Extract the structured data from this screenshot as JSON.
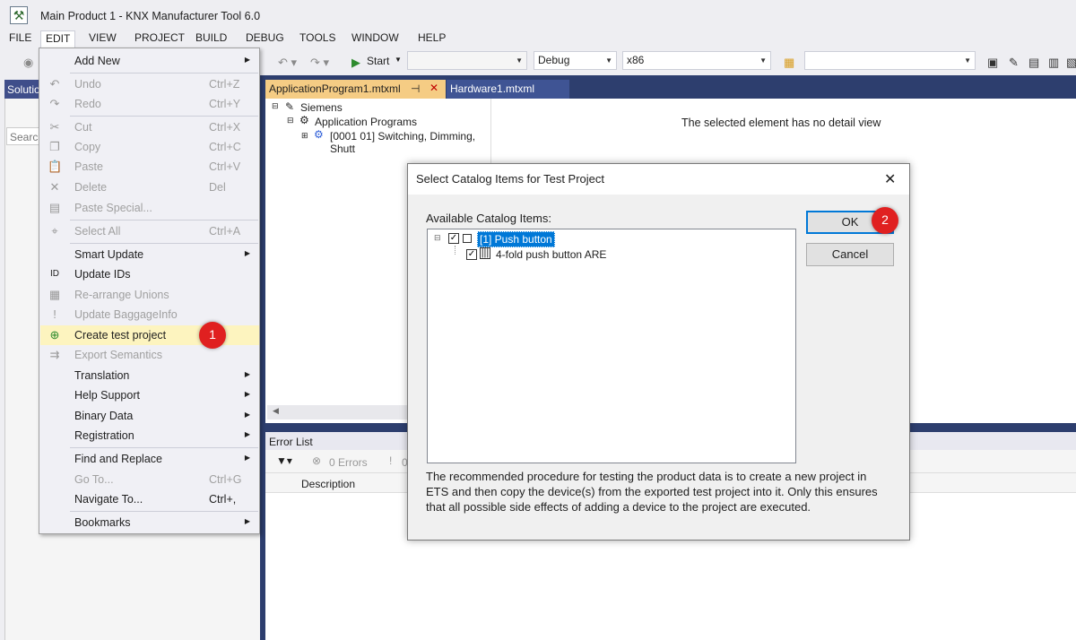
{
  "window": {
    "title": "Main Product 1 - KNX Manufacturer Tool 6.0"
  },
  "menubar": [
    "FILE",
    "EDIT",
    "VIEW",
    "PROJECT",
    "BUILD",
    "DEBUG",
    "TOOLS",
    "WINDOW",
    "HELP"
  ],
  "toolbar": {
    "start_label": "Start",
    "config": "Debug",
    "platform": "x86"
  },
  "solution": {
    "header": "Solutio",
    "search_placeholder": "Search"
  },
  "tabs": {
    "active": "ApplicationProgram1.mtxml",
    "other": "Hardware1.mtxml"
  },
  "editor_tree": {
    "root": "Siemens",
    "child": "Application Programs",
    "item": "[0001 01] Switching, Dimming, Shutt"
  },
  "detail": {
    "message": "The selected element has no detail view"
  },
  "errors": {
    "title": "Error List",
    "count_label": "0 Errors",
    "col_description": "Description",
    "warn_partial": "0"
  },
  "edit_menu": {
    "items": [
      {
        "label": "Add New",
        "shortcut": "",
        "disabled": false,
        "submenu": true,
        "icon": ""
      },
      {
        "label": "Undo",
        "shortcut": "Ctrl+Z",
        "disabled": true,
        "submenu": false,
        "icon": "undo-icon"
      },
      {
        "label": "Redo",
        "shortcut": "Ctrl+Y",
        "disabled": true,
        "submenu": false,
        "icon": "redo-icon"
      },
      {
        "label": "Cut",
        "shortcut": "Ctrl+X",
        "disabled": true,
        "submenu": false,
        "icon": "cut-icon"
      },
      {
        "label": "Copy",
        "shortcut": "Ctrl+C",
        "disabled": true,
        "submenu": false,
        "icon": "copy-icon"
      },
      {
        "label": "Paste",
        "shortcut": "Ctrl+V",
        "disabled": true,
        "submenu": false,
        "icon": "paste-icon"
      },
      {
        "label": "Delete",
        "shortcut": "Del",
        "disabled": true,
        "submenu": false,
        "icon": "delete-icon"
      },
      {
        "label": "Paste Special...",
        "shortcut": "",
        "disabled": true,
        "submenu": false,
        "icon": "paste-special-icon"
      },
      {
        "label": "Select All",
        "shortcut": "Ctrl+A",
        "disabled": true,
        "submenu": false,
        "icon": "select-all-icon"
      },
      {
        "label": "Smart Update",
        "shortcut": "",
        "disabled": false,
        "submenu": true,
        "icon": ""
      },
      {
        "label": "Update IDs",
        "shortcut": "",
        "disabled": false,
        "submenu": false,
        "icon": "update-ids-icon"
      },
      {
        "label": "Re-arrange Unions",
        "shortcut": "",
        "disabled": true,
        "submenu": false,
        "icon": "rearrange-icon"
      },
      {
        "label": "Update BaggageInfo",
        "shortcut": "",
        "disabled": true,
        "submenu": false,
        "icon": "baggage-icon"
      },
      {
        "label": "Create test project",
        "shortcut": "",
        "disabled": false,
        "submenu": false,
        "icon": "create-project-icon"
      },
      {
        "label": "Export Semantics",
        "shortcut": "",
        "disabled": true,
        "submenu": false,
        "icon": "export-icon"
      },
      {
        "label": "Translation",
        "shortcut": "",
        "disabled": false,
        "submenu": true,
        "icon": ""
      },
      {
        "label": "Help Support",
        "shortcut": "",
        "disabled": false,
        "submenu": true,
        "icon": ""
      },
      {
        "label": "Binary Data",
        "shortcut": "",
        "disabled": false,
        "submenu": true,
        "icon": ""
      },
      {
        "label": "Registration",
        "shortcut": "",
        "disabled": false,
        "submenu": true,
        "icon": ""
      },
      {
        "label": "Find and Replace",
        "shortcut": "",
        "disabled": false,
        "submenu": true,
        "icon": ""
      },
      {
        "label": "Go To...",
        "shortcut": "Ctrl+G",
        "disabled": true,
        "submenu": false,
        "icon": ""
      },
      {
        "label": "Navigate To...",
        "shortcut": "Ctrl+,",
        "disabled": false,
        "submenu": false,
        "icon": ""
      },
      {
        "label": "Bookmarks",
        "shortcut": "",
        "disabled": false,
        "submenu": true,
        "icon": ""
      }
    ],
    "badge": "1"
  },
  "dialog": {
    "title": "Select Catalog Items for Test Project",
    "available_label": "Available Catalog Items:",
    "tree": [
      {
        "label": "[1] Push button",
        "checked": true,
        "selected": true,
        "level": 0
      },
      {
        "label": "4-fold push button ARE",
        "checked": true,
        "selected": false,
        "level": 1
      }
    ],
    "ok_label": "OK",
    "cancel_label": "Cancel",
    "badge": "2",
    "note": "The recommended procedure for testing the product data is to create a new project in ETS and then copy the device(s) from the exported test project into it. Only this ensures that all possible side effects of adding a device to the project are executed."
  },
  "colors": {
    "accent": "#0078d7",
    "tab_active": "#f5cc84",
    "panel_dark": "#2d3e6e",
    "badge": "#e02020",
    "highlight": "#fdf4bf"
  }
}
